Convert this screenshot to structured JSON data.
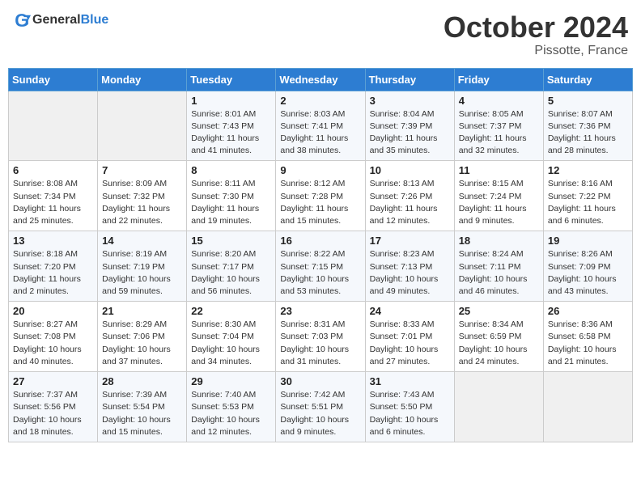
{
  "header": {
    "logo_general": "General",
    "logo_blue": "Blue",
    "month": "October 2024",
    "location": "Pissotte, France"
  },
  "weekdays": [
    "Sunday",
    "Monday",
    "Tuesday",
    "Wednesday",
    "Thursday",
    "Friday",
    "Saturday"
  ],
  "weeks": [
    [
      {
        "day": "",
        "info": ""
      },
      {
        "day": "",
        "info": ""
      },
      {
        "day": "1",
        "info": "Sunrise: 8:01 AM\nSunset: 7:43 PM\nDaylight: 11 hours and 41 minutes."
      },
      {
        "day": "2",
        "info": "Sunrise: 8:03 AM\nSunset: 7:41 PM\nDaylight: 11 hours and 38 minutes."
      },
      {
        "day": "3",
        "info": "Sunrise: 8:04 AM\nSunset: 7:39 PM\nDaylight: 11 hours and 35 minutes."
      },
      {
        "day": "4",
        "info": "Sunrise: 8:05 AM\nSunset: 7:37 PM\nDaylight: 11 hours and 32 minutes."
      },
      {
        "day": "5",
        "info": "Sunrise: 8:07 AM\nSunset: 7:36 PM\nDaylight: 11 hours and 28 minutes."
      }
    ],
    [
      {
        "day": "6",
        "info": "Sunrise: 8:08 AM\nSunset: 7:34 PM\nDaylight: 11 hours and 25 minutes."
      },
      {
        "day": "7",
        "info": "Sunrise: 8:09 AM\nSunset: 7:32 PM\nDaylight: 11 hours and 22 minutes."
      },
      {
        "day": "8",
        "info": "Sunrise: 8:11 AM\nSunset: 7:30 PM\nDaylight: 11 hours and 19 minutes."
      },
      {
        "day": "9",
        "info": "Sunrise: 8:12 AM\nSunset: 7:28 PM\nDaylight: 11 hours and 15 minutes."
      },
      {
        "day": "10",
        "info": "Sunrise: 8:13 AM\nSunset: 7:26 PM\nDaylight: 11 hours and 12 minutes."
      },
      {
        "day": "11",
        "info": "Sunrise: 8:15 AM\nSunset: 7:24 PM\nDaylight: 11 hours and 9 minutes."
      },
      {
        "day": "12",
        "info": "Sunrise: 8:16 AM\nSunset: 7:22 PM\nDaylight: 11 hours and 6 minutes."
      }
    ],
    [
      {
        "day": "13",
        "info": "Sunrise: 8:18 AM\nSunset: 7:20 PM\nDaylight: 11 hours and 2 minutes."
      },
      {
        "day": "14",
        "info": "Sunrise: 8:19 AM\nSunset: 7:19 PM\nDaylight: 10 hours and 59 minutes."
      },
      {
        "day": "15",
        "info": "Sunrise: 8:20 AM\nSunset: 7:17 PM\nDaylight: 10 hours and 56 minutes."
      },
      {
        "day": "16",
        "info": "Sunrise: 8:22 AM\nSunset: 7:15 PM\nDaylight: 10 hours and 53 minutes."
      },
      {
        "day": "17",
        "info": "Sunrise: 8:23 AM\nSunset: 7:13 PM\nDaylight: 10 hours and 49 minutes."
      },
      {
        "day": "18",
        "info": "Sunrise: 8:24 AM\nSunset: 7:11 PM\nDaylight: 10 hours and 46 minutes."
      },
      {
        "day": "19",
        "info": "Sunrise: 8:26 AM\nSunset: 7:09 PM\nDaylight: 10 hours and 43 minutes."
      }
    ],
    [
      {
        "day": "20",
        "info": "Sunrise: 8:27 AM\nSunset: 7:08 PM\nDaylight: 10 hours and 40 minutes."
      },
      {
        "day": "21",
        "info": "Sunrise: 8:29 AM\nSunset: 7:06 PM\nDaylight: 10 hours and 37 minutes."
      },
      {
        "day": "22",
        "info": "Sunrise: 8:30 AM\nSunset: 7:04 PM\nDaylight: 10 hours and 34 minutes."
      },
      {
        "day": "23",
        "info": "Sunrise: 8:31 AM\nSunset: 7:03 PM\nDaylight: 10 hours and 31 minutes."
      },
      {
        "day": "24",
        "info": "Sunrise: 8:33 AM\nSunset: 7:01 PM\nDaylight: 10 hours and 27 minutes."
      },
      {
        "day": "25",
        "info": "Sunrise: 8:34 AM\nSunset: 6:59 PM\nDaylight: 10 hours and 24 minutes."
      },
      {
        "day": "26",
        "info": "Sunrise: 8:36 AM\nSunset: 6:58 PM\nDaylight: 10 hours and 21 minutes."
      }
    ],
    [
      {
        "day": "27",
        "info": "Sunrise: 7:37 AM\nSunset: 5:56 PM\nDaylight: 10 hours and 18 minutes."
      },
      {
        "day": "28",
        "info": "Sunrise: 7:39 AM\nSunset: 5:54 PM\nDaylight: 10 hours and 15 minutes."
      },
      {
        "day": "29",
        "info": "Sunrise: 7:40 AM\nSunset: 5:53 PM\nDaylight: 10 hours and 12 minutes."
      },
      {
        "day": "30",
        "info": "Sunrise: 7:42 AM\nSunset: 5:51 PM\nDaylight: 10 hours and 9 minutes."
      },
      {
        "day": "31",
        "info": "Sunrise: 7:43 AM\nSunset: 5:50 PM\nDaylight: 10 hours and 6 minutes."
      },
      {
        "day": "",
        "info": ""
      },
      {
        "day": "",
        "info": ""
      }
    ]
  ]
}
